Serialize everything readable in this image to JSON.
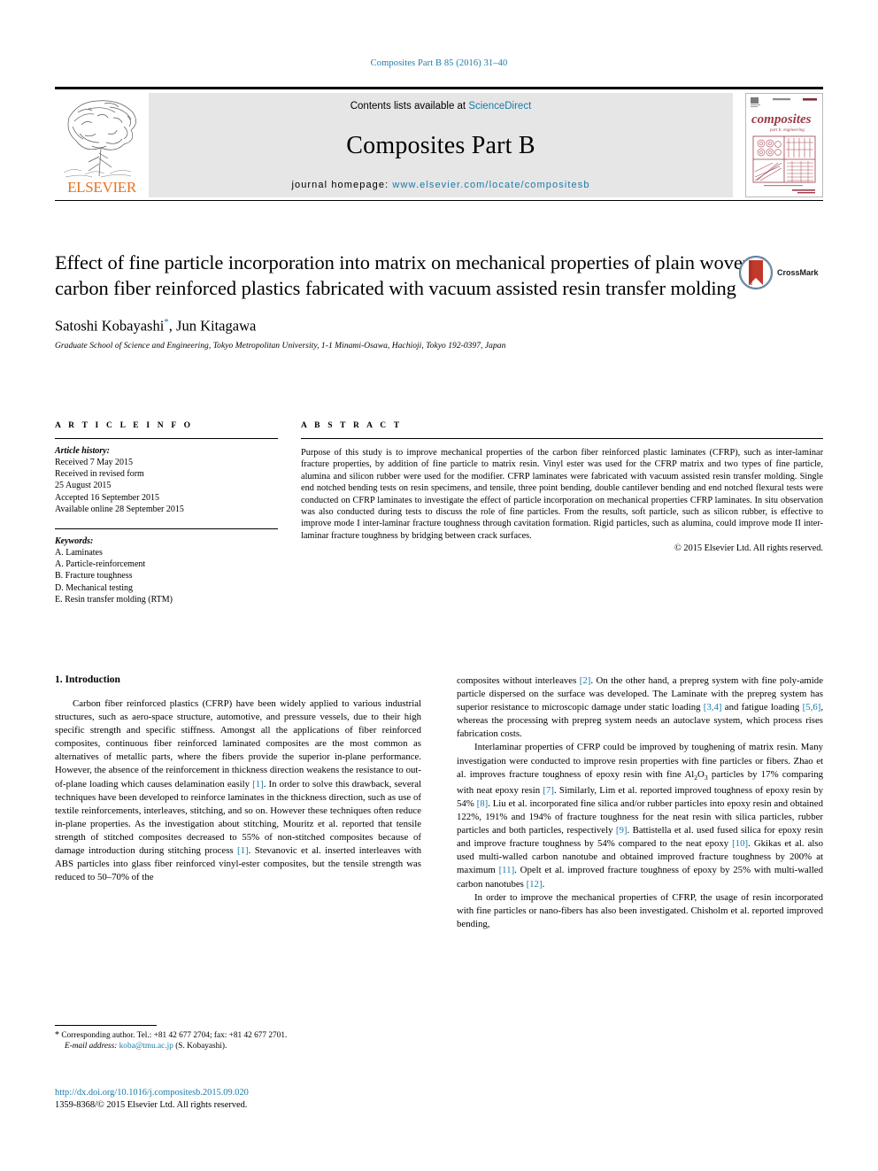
{
  "running_head": "Composites Part B 85 (2016) 31–40",
  "masthead": {
    "publisher": "ELSEVIER",
    "contents_prefix": "Contents lists available at ",
    "contents_link": "ScienceDirect",
    "journal_title": "Composites Part B",
    "homepage_prefix": "journal homepage: ",
    "homepage_url": "www.elsevier.com/locate/compositesb",
    "cover_title": "composites",
    "cover_subtitle": "part b: engineering",
    "cover_brand": "ELSEVIER"
  },
  "article": {
    "title": "Effect of fine particle incorporation into matrix on mechanical properties of plain woven carbon fiber reinforced plastics fabricated with vacuum assisted resin transfer molding",
    "authors": "Satoshi Kobayashi",
    "authors_mark": "*",
    "authors_rest": ", Jun Kitagawa",
    "affiliation": "Graduate School of Science and Engineering, Tokyo Metropolitan University, 1-1 Minami-Osawa, Hachioji, Tokyo 192-0397, Japan",
    "crossmark_label": "CrossMark"
  },
  "info": {
    "heading": "A R T I C L E  I N F O",
    "history_label": "Article history:",
    "history": [
      "Received 7 May 2015",
      "Received in revised form",
      "25 August 2015",
      "Accepted 16 September 2015",
      "Available online 28 September 2015"
    ],
    "keywords_label": "Keywords:",
    "keywords": [
      "A. Laminates",
      "A. Particle-reinforcement",
      "B. Fracture toughness",
      "D. Mechanical testing",
      "E. Resin transfer molding (RTM)"
    ]
  },
  "abstract": {
    "heading": "A B S T R A C T",
    "text": "Purpose of this study is to improve mechanical properties of the carbon fiber reinforced plastic laminates (CFRP), such as inter-laminar fracture properties, by addition of fine particle to matrix resin. Vinyl ester was used for the CFRP matrix and two types of fine particle, alumina and silicon rubber were used for the modifier. CFRP laminates were fabricated with vacuum assisted resin transfer molding. Single end notched bending tests on resin specimens, and tensile, three point bending, double cantilever bending and end notched flexural tests were conducted on CFRP laminates to investigate the effect of particle incorporation on mechanical properties CFRP laminates. In situ observation was also conducted during tests to discuss the role of fine particles. From the results, soft particle, such as silicon rubber, is effective to improve mode I inter-laminar fracture toughness through cavitation formation. Rigid particles, such as alumina, could improve mode II inter-laminar fracture toughness by bridging between crack surfaces.",
    "copyright": "© 2015 Elsevier Ltd. All rights reserved."
  },
  "intro": {
    "heading": "1. Introduction",
    "left_paragraphs": [
      "Carbon fiber reinforced plastics (CFRP) have been widely applied to various industrial structures, such as aero-space structure, automotive, and pressure vessels, due to their high specific strength and specific stiffness. Amongst all the applications of fiber reinforced composites, continuous fiber reinforced laminated composites are the most common as alternatives of metallic parts, where the fibers provide the superior in-plane performance. However, the absence of the reinforcement in thickness direction weakens the resistance to out-of-plane loading which causes delamination easily [1]. In order to solve this drawback, several techniques have been developed to reinforce laminates in the thickness direction, such as use of textile reinforcements, interleaves, stitching, and so on. However these techniques often reduce in-plane properties. As the investigation about stitching, Mouritz et al. reported that tensile strength of stitched composites decreased to 55% of non-stitched composites because of damage introduction during stitching process [1]. Stevanovic et al. inserted interleaves with ABS particles into glass fiber reinforced vinyl-ester composites, but the tensile strength was reduced to 50–70% of the"
    ],
    "right_paragraphs": [
      "composites without interleaves [2]. On the other hand, a prepreg system with fine poly-amide particle dispersed on the surface was developed. The Laminate with the prepreg system has superior resistance to microscopic damage under static loading [3,4] and fatigue loading [5,6], whereas the processing with prepreg system needs an autoclave system, which process rises fabrication costs.",
      "Interlaminar properties of CFRP could be improved by toughening of matrix resin. Many investigation were conducted to improve resin properties with fine particles or fibers. Zhao et al. improves fracture toughness of epoxy resin with fine Al2O3 particles by 17% comparing with neat epoxy resin [7]. Similarly, Lim et al. reported improved toughness of epoxy resin by 54% [8]. Liu et al. incorporated fine silica and/or rubber particles into epoxy resin and obtained 122%, 191% and 194% of fracture toughness for the neat resin with silica particles, rubber particles and both particles, respectively [9]. Battistella et al. used fused silica for epoxy resin and improve fracture toughness by 54% compared to the neat epoxy [10]. Gkikas et al. also used multi-walled carbon nanotube and obtained improved fracture toughness by 200% at maximum [11]. Opelt et al. improved fracture toughness of epoxy by 25% with multi-walled carbon nanotubes [12].",
      "In order to improve the mechanical properties of CFRP, the usage of resin incorporated with fine particles or nano-fibers has also been investigated. Chisholm et al. reported improved bending,"
    ]
  },
  "footnote": {
    "star": "*",
    "corresponding": "Corresponding author. Tel.: +81 42 677 2704; fax: +81 42 677 2701.",
    "email_label": "E-mail address:",
    "email": "koba@tmu.ac.jp",
    "email_suffix": "(S. Kobayashi)."
  },
  "doi": {
    "url": "http://dx.doi.org/10.1016/j.compositesb.2015.09.020",
    "issn_line": "1359-8368/© 2015 Elsevier Ltd. All rights reserved."
  },
  "colors": {
    "link": "#1a7ba8",
    "elsevier_orange": "#E8721C",
    "masthead_bg": "#e6e6e6",
    "cover_accent": "#9c3a46"
  }
}
